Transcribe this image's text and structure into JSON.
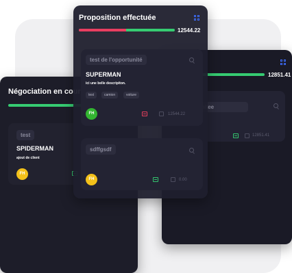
{
  "right_card": {
    "amount": "12851.41",
    "deal_title": "test de l'opprtunitee",
    "amount_value": "12851.41"
  },
  "left_card": {
    "title": "Négociation en cours",
    "deal_title": "test",
    "deal_name": "SPIDERMAN",
    "deal_description": "ajout de client",
    "avatar_initials": "FH"
  },
  "center_card": {
    "title": "Proposition effectuée",
    "amount": "12544.22",
    "progress_red_pct": 49,
    "deal1": {
      "title": "test de l'opportunité",
      "name": "SUPERMAN",
      "description": "ici une belle descripiton.",
      "tags": [
        "test",
        "camion",
        "voiture"
      ],
      "avatar_initials": "FH",
      "amount": "12544.22"
    },
    "deal2": {
      "title": "sdffgsdf",
      "avatar_initials": "FH",
      "amount": "0.00"
    }
  },
  "colors": {
    "progress_green": "#36cc72",
    "progress_red": "#e93e60",
    "accent_blue": "#3d6dff",
    "avatar_green": "#33b531",
    "avatar_yellow": "#f3c11a"
  }
}
